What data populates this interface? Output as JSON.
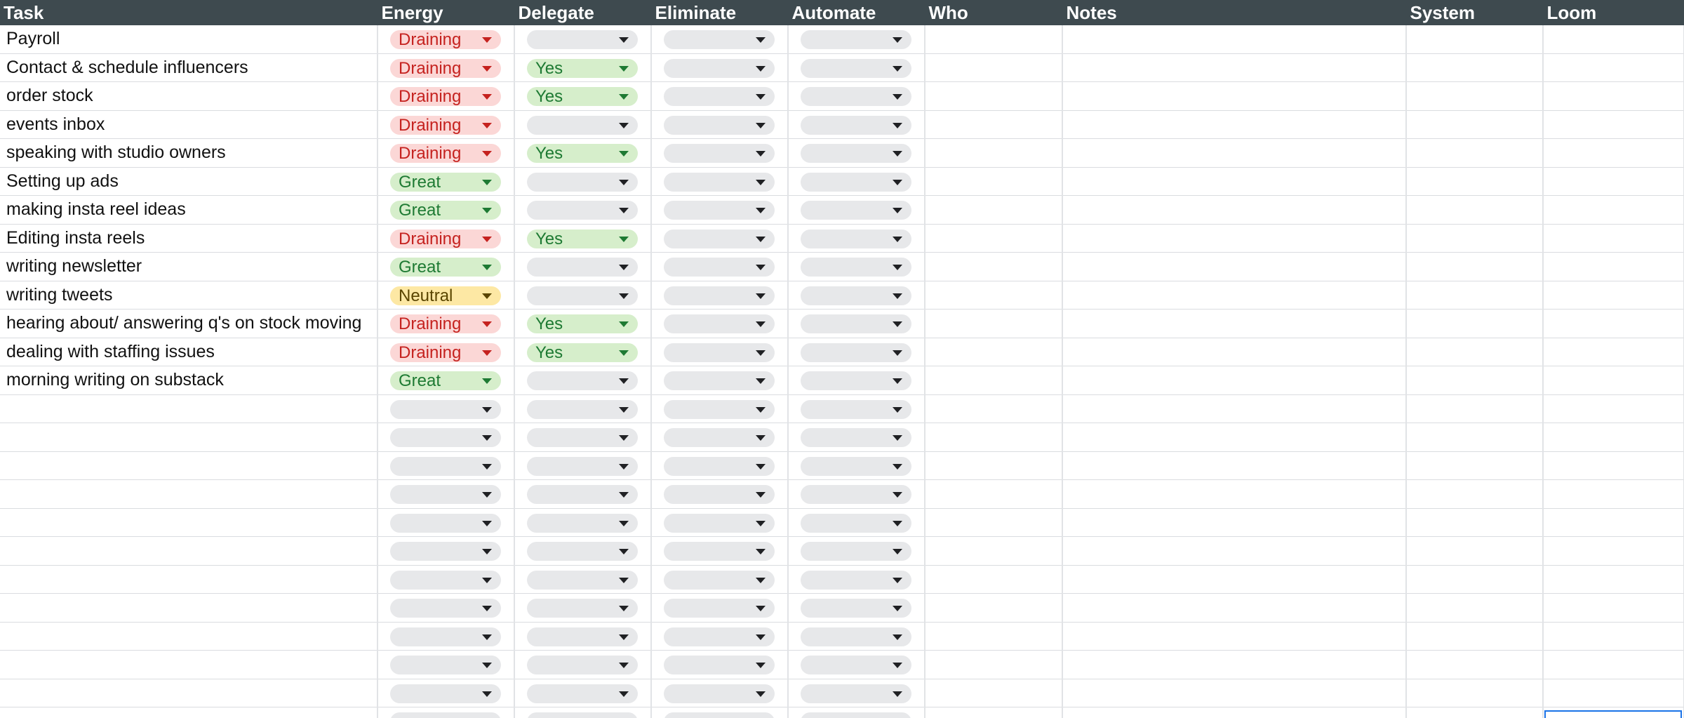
{
  "columns": [
    "Task",
    "Energy",
    "Delegate",
    "Eliminate",
    "Automate",
    "Who",
    "Notes",
    "System",
    "Loom"
  ],
  "colors": {
    "header_bg": "#3e4a4f",
    "draining": "#fbd7d6",
    "great_yes": "#d6eecb",
    "neutral": "#fde8a4",
    "empty_chip": "#e7e8ea",
    "selection": "#1a73e8"
  },
  "icons": {
    "dropdown": "dropdown-arrow-icon"
  },
  "rows": [
    {
      "task": "Payroll",
      "energy": "Draining",
      "delegate": "",
      "eliminate": "",
      "automate": ""
    },
    {
      "task": "Contact & schedule influencers",
      "energy": "Draining",
      "delegate": "Yes",
      "eliminate": "",
      "automate": ""
    },
    {
      "task": "order stock",
      "energy": "Draining",
      "delegate": "Yes",
      "eliminate": "",
      "automate": ""
    },
    {
      "task": "events inbox",
      "energy": "Draining",
      "delegate": "",
      "eliminate": "",
      "automate": ""
    },
    {
      "task": "speaking with studio owners",
      "energy": "Draining",
      "delegate": "Yes",
      "eliminate": "",
      "automate": ""
    },
    {
      "task": "Setting up ads",
      "energy": "Great",
      "delegate": "",
      "eliminate": "",
      "automate": ""
    },
    {
      "task": "making insta reel ideas",
      "energy": "Great",
      "delegate": "",
      "eliminate": "",
      "automate": ""
    },
    {
      "task": "Editing insta reels",
      "energy": "Draining",
      "delegate": "Yes",
      "eliminate": "",
      "automate": ""
    },
    {
      "task": "writing newsletter",
      "energy": "Great",
      "delegate": "",
      "eliminate": "",
      "automate": ""
    },
    {
      "task": "writing tweets",
      "energy": "Neutral",
      "delegate": "",
      "eliminate": "",
      "automate": ""
    },
    {
      "task": "hearing about/ answering q's on stock moving",
      "energy": "Draining",
      "delegate": "Yes",
      "eliminate": "",
      "automate": ""
    },
    {
      "task": "dealing with staffing issues",
      "energy": "Draining",
      "delegate": "Yes",
      "eliminate": "",
      "automate": ""
    },
    {
      "task": "morning writing on substack",
      "energy": "Great",
      "delegate": "",
      "eliminate": "",
      "automate": ""
    },
    {
      "task": "",
      "energy": "",
      "delegate": "",
      "eliminate": "",
      "automate": ""
    },
    {
      "task": "",
      "energy": "",
      "delegate": "",
      "eliminate": "",
      "automate": ""
    },
    {
      "task": "",
      "energy": "",
      "delegate": "",
      "eliminate": "",
      "automate": ""
    },
    {
      "task": "",
      "energy": "",
      "delegate": "",
      "eliminate": "",
      "automate": ""
    },
    {
      "task": "",
      "energy": "",
      "delegate": "",
      "eliminate": "",
      "automate": ""
    },
    {
      "task": "",
      "energy": "",
      "delegate": "",
      "eliminate": "",
      "automate": ""
    },
    {
      "task": "",
      "energy": "",
      "delegate": "",
      "eliminate": "",
      "automate": ""
    },
    {
      "task": "",
      "energy": "",
      "delegate": "",
      "eliminate": "",
      "automate": ""
    },
    {
      "task": "",
      "energy": "",
      "delegate": "",
      "eliminate": "",
      "automate": ""
    },
    {
      "task": "",
      "energy": "",
      "delegate": "",
      "eliminate": "",
      "automate": ""
    },
    {
      "task": "",
      "energy": "",
      "delegate": "",
      "eliminate": "",
      "automate": ""
    },
    {
      "task": "",
      "energy": "",
      "delegate": "",
      "eliminate": "",
      "automate": ""
    }
  ]
}
